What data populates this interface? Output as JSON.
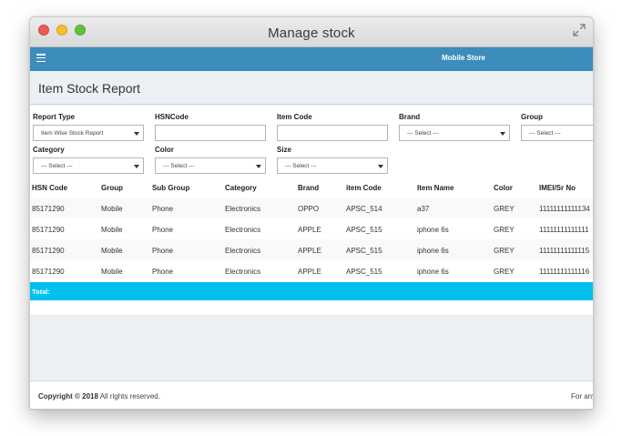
{
  "window": {
    "title": "Manage stock"
  },
  "navbar": {
    "store_name": "Mobile Store"
  },
  "page": {
    "title": "Item Stock Report"
  },
  "filters": {
    "report_type": {
      "label": "Report Type",
      "value": "Item Wise Stock Report"
    },
    "hsn_code": {
      "label": "HSNCode",
      "value": ""
    },
    "item_code": {
      "label": "Item Code",
      "value": ""
    },
    "brand": {
      "label": "Brand",
      "value": "--- Select ---"
    },
    "group": {
      "label": "Group",
      "value": "--- Select ---"
    },
    "category": {
      "label": "Category",
      "value": "--- Select ---"
    },
    "color": {
      "label": "Color",
      "value": "--- Select ---"
    },
    "size": {
      "label": "Size",
      "value": "--- Select ---"
    }
  },
  "table": {
    "headers": [
      "HSN Code",
      "Group",
      "Sub Group",
      "Category",
      "Brand",
      "item Code",
      "Item Name",
      "Color",
      "IMEI/Sr No"
    ],
    "rows": [
      [
        "85171290",
        "Mobile",
        "Phone",
        "Electronics",
        "OPPO",
        "APSC_514",
        "a37",
        "GREY",
        "11111111111134"
      ],
      [
        "85171290",
        "Mobile",
        "Phone",
        "Electronics",
        "APPLE",
        "APSC_515",
        "iphone 6s",
        "GREY",
        "11111111111111"
      ],
      [
        "85171290",
        "Mobile",
        "Phone",
        "Electronics",
        "APPLE",
        "APSC_515",
        "iphone 6s",
        "GREY",
        "11111111111115"
      ],
      [
        "85171290",
        "Mobile",
        "Phone",
        "Electronics",
        "APPLE",
        "APSC_515",
        "iphone 6s",
        "GREY",
        "11111111111116"
      ]
    ],
    "total_label": "Total:"
  },
  "footer": {
    "copyright_strong": "Copyright © 2018",
    "copyright_rest": " All rights reserved.",
    "right_text": "For any"
  },
  "colors": {
    "navbar": "#3c8dbc",
    "total_bar": "#00c0ef",
    "content_bg": "#ecf0f5"
  }
}
